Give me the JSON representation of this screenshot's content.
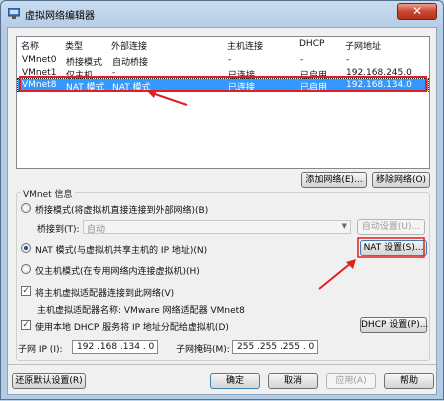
{
  "window": {
    "title": "虚拟网络编辑器",
    "close_glyph": "✕"
  },
  "table": {
    "headers": [
      "名称",
      "类型",
      "外部连接",
      "主机连接",
      "DHCP",
      "子网地址"
    ],
    "rows": [
      [
        "VMnet0",
        "桥接模式",
        "自动桥接",
        "-",
        "-",
        "-"
      ],
      [
        "VMnet1",
        "仅主机...",
        "-",
        "已连接",
        "已启用",
        "192.168.245.0"
      ],
      [
        "VMnet8",
        "NAT 模式",
        "NAT 模式",
        "已连接",
        "已启用",
        "192.168.134.0"
      ]
    ],
    "selected_row": 2
  },
  "list_buttons": {
    "add": "添加网络(E)...",
    "remove": "移除网络(O)"
  },
  "vmnet_info": {
    "label": "VMnet 信息",
    "bridged_mode": "桥接模式(将虚拟机直接连接到外部网络)(B)",
    "bridged_to_label": "桥接到(T):",
    "bridged_to_value": "自动",
    "auto_settings": "自动设置(U)...",
    "nat_mode": "NAT 模式(与虚拟机共享主机的 IP 地址)(N)",
    "nat_settings": "NAT 设置(S)...",
    "host_only": "仅主机模式(在专用网络内连接虚拟机)(H)",
    "selected_mode": "nat",
    "connect_adapter": "将主机虚拟适配器连接到此网络(V)",
    "connect_adapter_checked": true,
    "adapter_name": "主机虚拟适配器名称: VMware 网络适配器 VMnet8",
    "use_dhcp": "使用本地 DHCP 服务将 IP 地址分配给虚拟机(D)",
    "use_dhcp_checked": true,
    "dhcp_settings": "DHCP 设置(P)..."
  },
  "subnet": {
    "ip_label": "子网 IP (I):",
    "ip_value": "192 .168 .134 . 0",
    "mask_label": "子网掩码(M):",
    "mask_value": "255 .255 .255 . 0"
  },
  "footer": {
    "restore": "还原默认设置(R)",
    "ok": "确定",
    "cancel": "取消",
    "apply": "应用(A)",
    "help": "帮助"
  },
  "icons": {
    "check": "✓",
    "dropdown": "▼"
  },
  "colors": {
    "selection": "#3399ff",
    "annotation_red": "#e02020"
  }
}
